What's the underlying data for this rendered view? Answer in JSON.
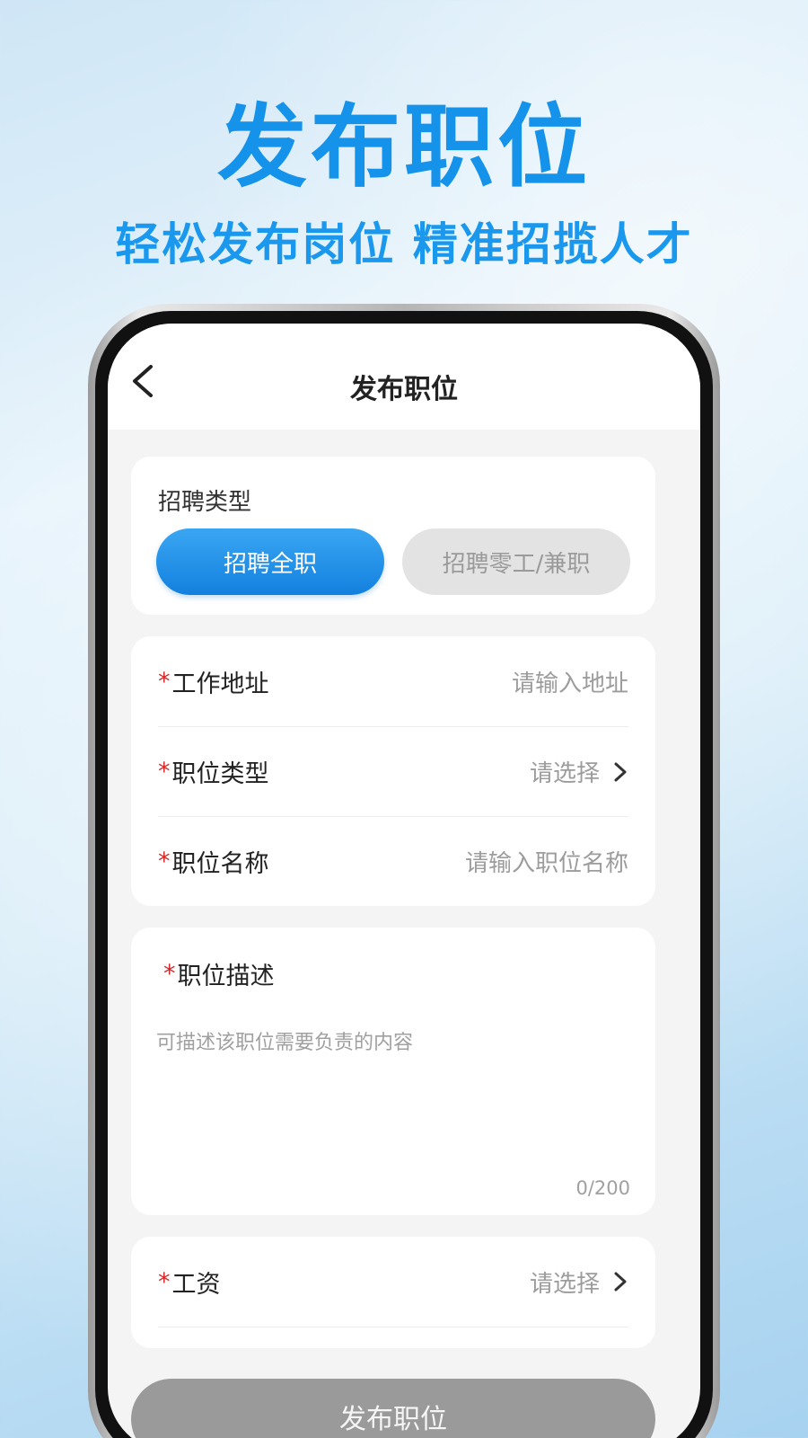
{
  "hero": {
    "title": "发布职位",
    "subtitle": "轻松发布岗位 精准招揽人才"
  },
  "nav": {
    "title": "发布职位",
    "back_icon": "chevron-left-icon"
  },
  "recruit_type": {
    "label": "招聘类型",
    "options": [
      {
        "label": "招聘全职",
        "selected": true
      },
      {
        "label": "招聘零工/兼职",
        "selected": false
      }
    ]
  },
  "fields": [
    {
      "required": "*",
      "label": "工作地址",
      "value": "请输入地址",
      "has_chevron": false
    },
    {
      "required": "*",
      "label": "职位类型",
      "value": "请选择",
      "has_chevron": true
    },
    {
      "required": "*",
      "label": "职位名称",
      "value": "请输入职位名称",
      "has_chevron": false
    }
  ],
  "description": {
    "required": "*",
    "label": "职位描述",
    "placeholder": "可描述该职位需要负责的内容",
    "counter": "0/200"
  },
  "salary": {
    "required": "*",
    "label": "工资",
    "value": "请选择"
  },
  "submit": {
    "label": "发布职位"
  },
  "colors": {
    "accent": "#1593ea",
    "required": "#d62828",
    "disabled_button": "#9a9a9a"
  }
}
